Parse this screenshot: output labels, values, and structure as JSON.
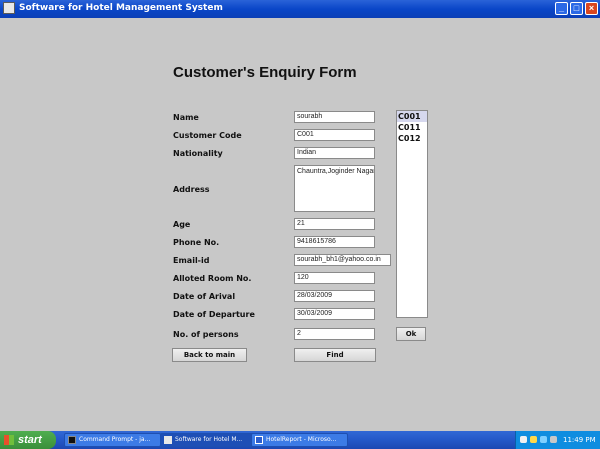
{
  "window": {
    "title": "Software for Hotel Management System",
    "minimize": "_",
    "maximize": "□",
    "close": "×"
  },
  "form": {
    "title": "Customer's Enquiry Form",
    "labels": {
      "name": "Name",
      "customer_code": "Customer Code",
      "nationality": "Nationality",
      "address": "Address",
      "age": "Age",
      "phone": "Phone No.",
      "email": "Email-id",
      "room": "Alloted Room No.",
      "arrival": "Date of Arival",
      "departure": "Date of Departure",
      "persons": "No. of persons"
    },
    "values": {
      "name": "sourabh",
      "customer_code": "C001",
      "nationality": "Indian",
      "address": "Chauntra,Joginder Nagar",
      "age": "21",
      "phone": "9418615786",
      "email": "sourabh_bh1@yahoo.co.in",
      "room": "120",
      "arrival": "28/03/2009",
      "departure": "30/03/2009",
      "persons": "2"
    },
    "codes": [
      "C001",
      "C011",
      "C012"
    ],
    "buttons": {
      "back": "Back to main",
      "find": "Find",
      "ok": "Ok"
    }
  },
  "taskbar": {
    "start": "start",
    "tasks": [
      "Command Prompt - ja...",
      "Software for Hotel M...",
      "HotelReport - Microso..."
    ],
    "clock": "11:49 PM"
  }
}
